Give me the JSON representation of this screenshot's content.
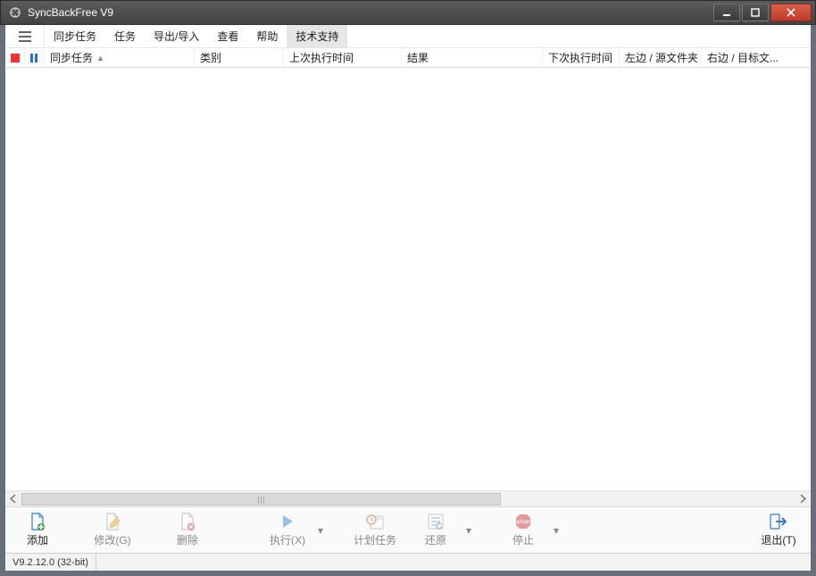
{
  "window": {
    "title": "SyncBackFree V9"
  },
  "menu": {
    "items": [
      "同步任务",
      "任务",
      "导出/导入",
      "查看",
      "帮助",
      "技术支持"
    ],
    "active_index": 5
  },
  "columns": [
    {
      "label": "同步任务",
      "width": 168,
      "sort": "asc"
    },
    {
      "label": "类别",
      "width": 100
    },
    {
      "label": "上次执行时间",
      "width": 132
    },
    {
      "label": "结果",
      "width": 158
    },
    {
      "label": "下次执行时间",
      "width": 86
    },
    {
      "label": "左边 / 源文件夹",
      "width": 92
    },
    {
      "label": "右边 / 目标文...",
      "width": 90
    }
  ],
  "toolbar": {
    "add": "添加",
    "modify": "修改(G)",
    "delete": "删除",
    "run": "执行(X)",
    "schedule": "计划任务",
    "restore": "还原",
    "stop": "停止",
    "exit": "退出(T)"
  },
  "status": {
    "version": "V9.2.12.0 (32-bit)"
  }
}
